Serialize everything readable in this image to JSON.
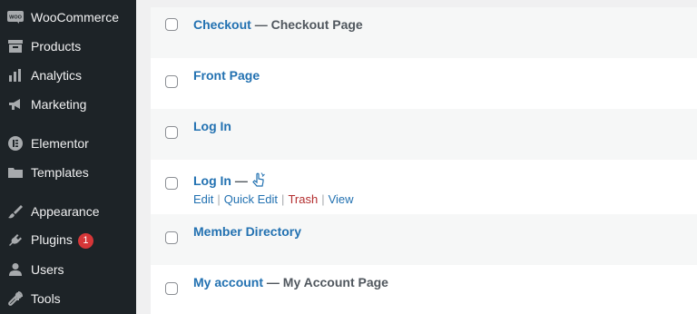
{
  "sidebar": {
    "items": [
      {
        "label": "WooCommerce",
        "icon": "woo-icon"
      },
      {
        "label": "Products",
        "icon": "archive-icon"
      },
      {
        "label": "Analytics",
        "icon": "bar-chart-icon"
      },
      {
        "label": "Marketing",
        "icon": "megaphone-icon"
      },
      {
        "label": "Elementor",
        "icon": "elementor-icon"
      },
      {
        "label": "Templates",
        "icon": "folder-icon"
      },
      {
        "label": "Appearance",
        "icon": "paintbrush-icon"
      },
      {
        "label": "Plugins",
        "icon": "plug-icon",
        "badge": "1"
      },
      {
        "label": "Users",
        "icon": "user-icon"
      },
      {
        "label": "Tools",
        "icon": "wrench-icon"
      }
    ],
    "background": "#1d2327",
    "badge_color": "#d63638"
  },
  "pages": {
    "rows": [
      {
        "title": "Checkout",
        "dash": "—",
        "state": "Checkout Page"
      },
      {
        "title": "Front Page"
      },
      {
        "title": "Log In"
      },
      {
        "title": "Log In",
        "dash": "—",
        "actions": {
          "edit": "Edit",
          "quick_edit": "Quick Edit",
          "trash": "Trash",
          "view": "View",
          "sep": "|"
        }
      },
      {
        "title": "Member Directory"
      },
      {
        "title": "My account",
        "dash": "—",
        "state": "My Account Page"
      }
    ],
    "link_color": "#2271b1",
    "trash_color": "#b32d2e"
  }
}
